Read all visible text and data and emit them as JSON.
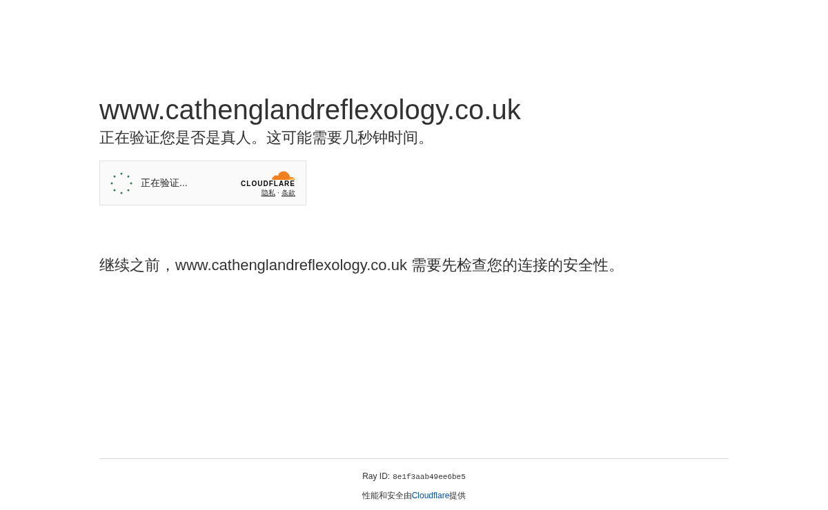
{
  "heading": "www.cathenglandreflexology.co.uk",
  "subheading": "正在验证您是否是真人。这可能需要几秒钟时间。",
  "widget": {
    "status": "正在验证...",
    "brand": "CLOUDFLARE",
    "links": [
      "隐私",
      "条款"
    ],
    "separator": "·"
  },
  "message": "继续之前，www.cathenglandreflexology.co.uk 需要先检查您的连接的安全性。",
  "footer": {
    "ray_label": "Ray ID:",
    "ray_id": "8e1f3aab49ee6be5",
    "credit_before": "性能和安全由",
    "credit_link": "Cloudflare",
    "credit_after": "提供"
  }
}
